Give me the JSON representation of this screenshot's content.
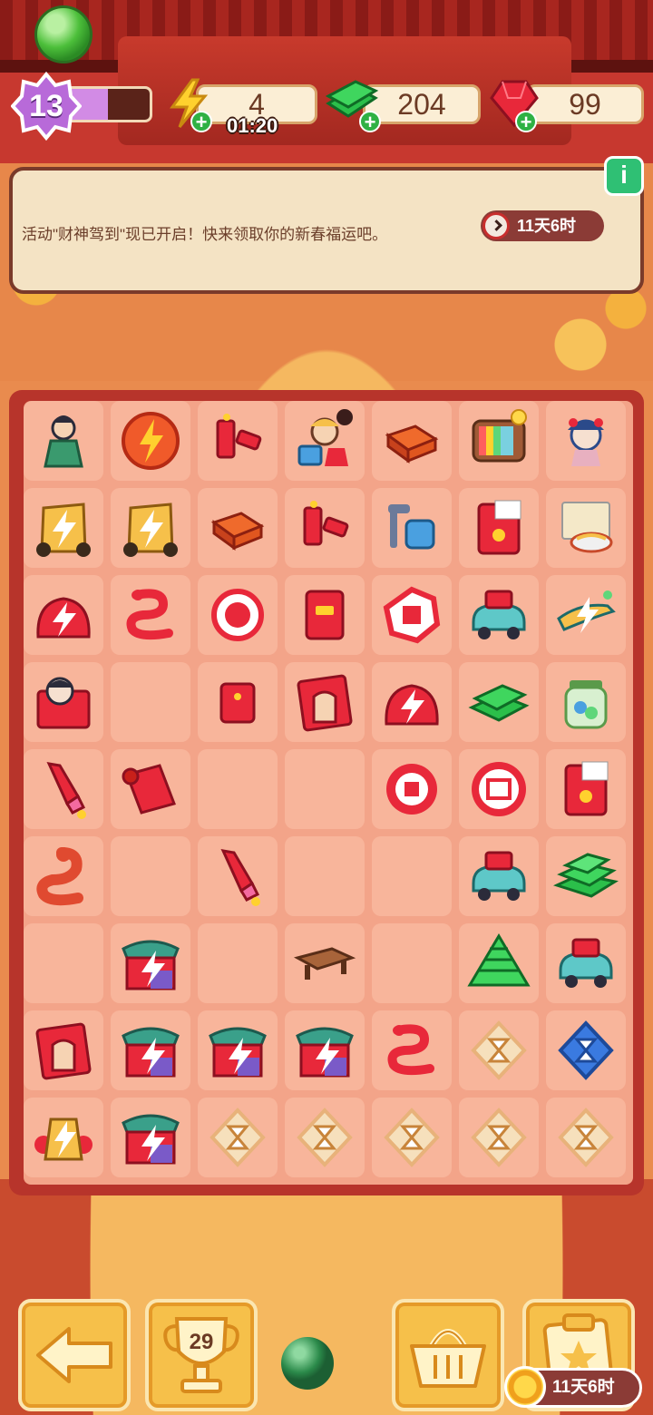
{
  "hud": {
    "level": "13",
    "level_progress": 0.55,
    "energy": "4",
    "energy_timer": "01:20",
    "cash": "204",
    "gems": "99"
  },
  "event_panel": {
    "message": "活动\"财神驾到\"现已开启！快来领取你的新春福运吧。",
    "timer": "11天6时"
  },
  "board": {
    "columns": 7,
    "rows": 9,
    "cells": [
      [
        "general",
        "energy-orb",
        "firecrackers",
        "merchant",
        "red-box",
        "tv",
        "opera-girl"
      ],
      [
        "gold-tree-gen",
        "gold-tree-gen",
        "red-box",
        "firecrackers",
        "vacuum",
        "red-envelope-card",
        "noodles"
      ],
      [
        "lantern-bag-gen",
        "snake",
        "fu-seal",
        "red-envelope",
        "xin-seal",
        "toy-car",
        "plane-gen"
      ],
      [
        "girl-card",
        "",
        "red-envelope-small",
        "door-card",
        "lantern-bag-gen",
        "cash-stack",
        "jar"
      ],
      [
        "rocket",
        "scroll",
        "",
        "",
        "an-seal",
        "kuai-seal",
        "red-envelope-card"
      ],
      [
        "snake-big",
        "",
        "rocket",
        "",
        "",
        "toy-car",
        "cash-pile"
      ],
      [
        "",
        "shop-gen",
        "",
        "bench",
        "",
        "cash-mountain",
        "toy-car"
      ],
      [
        "door-card",
        "shop-gen",
        "shop-gen",
        "shop-gen",
        "snake",
        "hourglass",
        "hourglass-blue"
      ],
      [
        "lantern-gen",
        "shop-gen",
        "hourglass",
        "hourglass",
        "hourglass",
        "hourglass",
        "hourglass"
      ]
    ]
  },
  "bottom": {
    "trophy_count": "29",
    "event_timer": "11天6时"
  },
  "colors": {
    "board_frame": "#b7342b",
    "cell": "#f8b59b",
    "button": "#f6c04a"
  }
}
